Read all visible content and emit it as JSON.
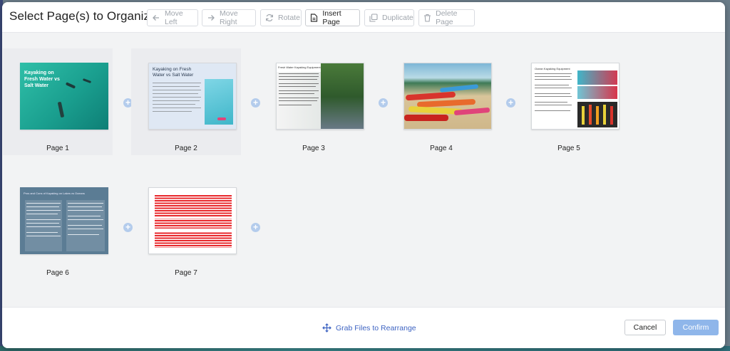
{
  "modal": {
    "title": "Select Page(s) to Organize"
  },
  "toolbar": {
    "move_left": "Move Left",
    "move_right": "Move Right",
    "rotate": "Rotate",
    "insert_page": "Insert Page",
    "duplicate": "Duplicate",
    "delete_page": "Delete Page"
  },
  "pages": [
    {
      "label": "Page 1",
      "heading": "Kayaking on Fresh Water vs Salt Water"
    },
    {
      "label": "Page 2",
      "heading": "Kayaking on Fresh Water vs Salt Water"
    },
    {
      "label": "Page 3",
      "heading": "Fresh Water Kayaking Equipment"
    },
    {
      "label": "Page 4",
      "heading": ""
    },
    {
      "label": "Page 5",
      "heading": "Ocean Kayaking Equipment"
    },
    {
      "label": "Page 6",
      "heading": "Pros and Cons of Kayaking on Lakes vs Oceans"
    },
    {
      "label": "Page 7",
      "heading": ""
    }
  ],
  "insert_marker": "+",
  "footer": {
    "grab_text": "Grab Files to Rearrange",
    "cancel": "Cancel",
    "confirm": "Confirm"
  },
  "colors": {
    "accent": "#3d63c2",
    "confirm_bg": "#8fb6ea",
    "insert_marker": "#b4ccec"
  }
}
